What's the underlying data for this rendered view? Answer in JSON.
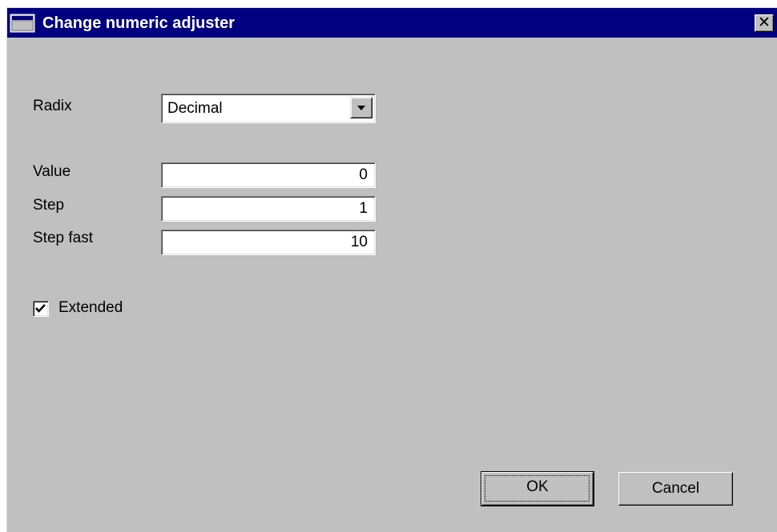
{
  "window": {
    "title": "Change numeric adjuster",
    "close_glyph": "✕",
    "icon": "window-icon"
  },
  "form": {
    "radix": {
      "label": "Radix",
      "selected": "Decimal"
    },
    "value": {
      "label": "Value",
      "value": "0"
    },
    "step": {
      "label": "Step",
      "value": "1"
    },
    "step_fast": {
      "label": "Step fast",
      "value": "10"
    },
    "extended": {
      "label": "Extended",
      "checked": true
    }
  },
  "buttons": {
    "ok": "OK",
    "cancel": "Cancel"
  },
  "colors": {
    "titlebar": "#000080",
    "face": "#c0c0c0",
    "field": "#ffffff"
  }
}
